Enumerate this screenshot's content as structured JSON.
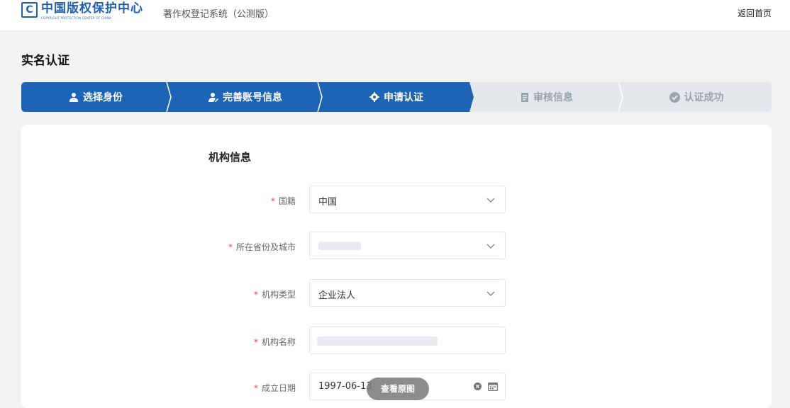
{
  "header": {
    "logo_mark": "C",
    "logo_cn": "中国版权保护中心",
    "logo_en": "COPYRIGHT PROTECTION CENTER OF CHINA",
    "system_name": "著作权登记系统（公测版）",
    "back_home": "返回首页"
  },
  "page_title": "实名认证",
  "steps": [
    {
      "label": "选择身份",
      "icon": "user-icon",
      "state": "done"
    },
    {
      "label": "完善账号信息",
      "icon": "user-edit-icon",
      "state": "done"
    },
    {
      "label": "申请认证",
      "icon": "gear-icon",
      "state": "current"
    },
    {
      "label": "审核信息",
      "icon": "document-icon",
      "state": "todo"
    },
    {
      "label": "认证成功",
      "icon": "check-circle-icon",
      "state": "todo"
    }
  ],
  "section_title": "机构信息",
  "form": {
    "nationality": {
      "label": "国籍",
      "value": "中国",
      "required": true
    },
    "province_city": {
      "label": "所在省份及城市",
      "value": "",
      "required": true
    },
    "org_type": {
      "label": "机构类型",
      "value": "企业法人",
      "required": true
    },
    "org_name": {
      "label": "机构名称",
      "value": "",
      "required": true
    },
    "found_date": {
      "label": "成立日期",
      "value": "1997-06-13",
      "required": true
    }
  },
  "required_mark": "*",
  "overlay_button": "查看原图",
  "colors": {
    "primary": "#1e64b4",
    "step_inactive": "#e4e7eb",
    "required": "#e54545"
  }
}
